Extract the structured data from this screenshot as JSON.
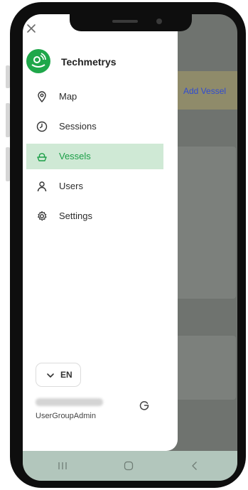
{
  "app": {
    "name": "Techmetrys"
  },
  "background": {
    "add_vessel_label": "Add Vessel"
  },
  "drawer": {
    "nav": [
      {
        "label": "Map",
        "icon": "map-pin-icon"
      },
      {
        "label": "Sessions",
        "icon": "clock-icon"
      },
      {
        "label": "Vessels",
        "icon": "vessel-icon",
        "active": true
      },
      {
        "label": "Users",
        "icon": "user-icon"
      },
      {
        "label": "Settings",
        "icon": "gear-icon"
      }
    ],
    "language": "EN",
    "user_role": "UserGroupAdmin"
  },
  "colors": {
    "accent": "#1fa74a",
    "active_bg": "#cfe9d5",
    "active_text": "#1a9e46",
    "scrim": "#6f736f",
    "add_vessel_text": "#2f4bd1"
  }
}
